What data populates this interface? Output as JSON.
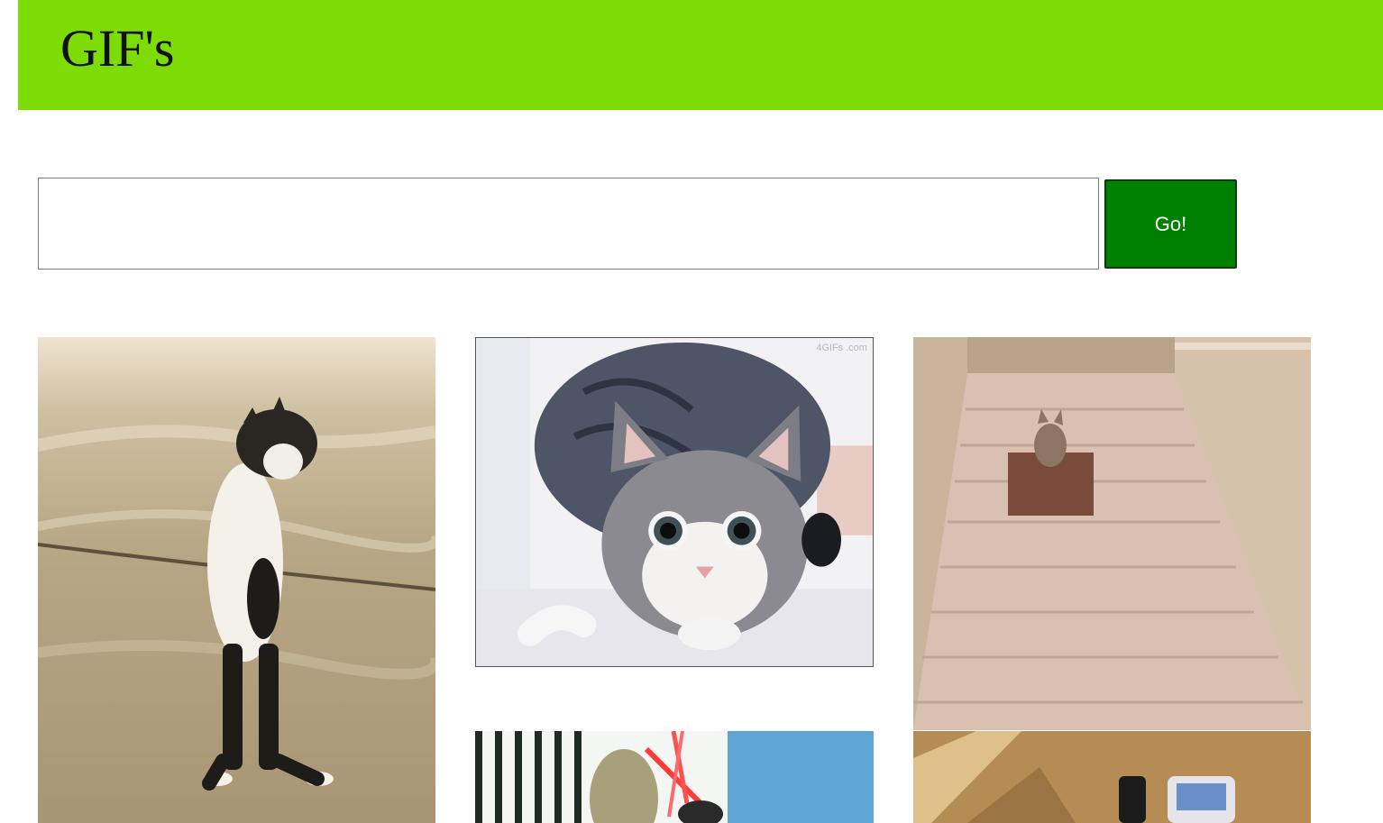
{
  "header": {
    "title": "GIF's"
  },
  "search": {
    "value": "",
    "placeholder": "",
    "button_label": "Go!"
  },
  "colors": {
    "header_bg": "#7ddc05",
    "button_bg": "#008000"
  },
  "gifs": [
    {
      "icon": "cat-standing-image"
    },
    {
      "icon": "cat-crouching-image"
    },
    {
      "icon": "cat-in-box-on-stairs-image"
    },
    {
      "icon": "cat-lightsaber-image"
    },
    {
      "icon": "cat-with-phone-image"
    }
  ],
  "watermark": {
    "text": "4GIFs .com"
  }
}
